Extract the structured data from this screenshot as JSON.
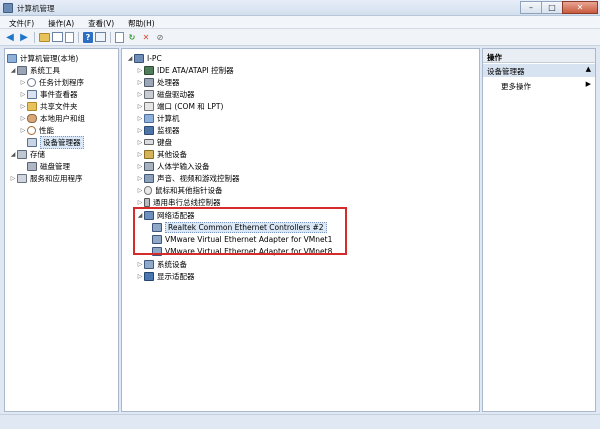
{
  "window": {
    "title": "计算机管理"
  },
  "window_buttons": {
    "minimize": "–",
    "maximize": "□",
    "close": "✕"
  },
  "menu": [
    "文件(F)",
    "操作(A)",
    "查看(V)",
    "帮助(H)"
  ],
  "toolbar_icons": [
    "back-arrow",
    "forward-arrow",
    "up-folder",
    "show-hide-tree",
    "properties",
    "help",
    "view-list",
    "export",
    "scan-hardware",
    "uninstall",
    "disable"
  ],
  "left_tree": [
    {
      "label": "计算机管理(本地)",
      "icon": "computer-icon"
    },
    {
      "label": "系统工具",
      "icon": "tools-icon"
    },
    {
      "label": "任务计划程序",
      "icon": "clock-icon"
    },
    {
      "label": "事件查看器",
      "icon": "event-icon"
    },
    {
      "label": "共享文件夹",
      "icon": "folder-share-icon"
    },
    {
      "label": "本地用户和组",
      "icon": "users-icon"
    },
    {
      "label": "性能",
      "icon": "performance-icon"
    },
    {
      "label": "设备管理器",
      "icon": "device-manager-icon"
    },
    {
      "label": "存储",
      "icon": "storage-icon"
    },
    {
      "label": "磁盘管理",
      "icon": "disk-icon"
    },
    {
      "label": "服务和应用程序",
      "icon": "services-icon"
    }
  ],
  "device_tree": {
    "root": "I-PC",
    "categories": [
      "IDE ATA/ATAPI 控制器",
      "处理器",
      "磁盘驱动器",
      "端口 (COM 和 LPT)",
      "计算机",
      "监视器",
      "键盘",
      "其他设备",
      "人体学输入设备",
      "声音、视频和游戏控制器",
      "鼠标和其他指针设备",
      "通用串行总线控制器",
      "网络适配器"
    ],
    "network_adapters": [
      "Realtek Common Ethernet Controllers #2",
      "VMware Virtual Ethernet Adapter for VMnet1",
      "VMware Virtual Ethernet Adapter for VMnet8"
    ],
    "after": [
      "系统设备",
      "显示适配器"
    ]
  },
  "actions": {
    "header": "操作",
    "section": "设备管理器",
    "more": "更多操作"
  },
  "colors": {
    "highlight": "#d62b2b",
    "selection": "#dbe8f7"
  }
}
